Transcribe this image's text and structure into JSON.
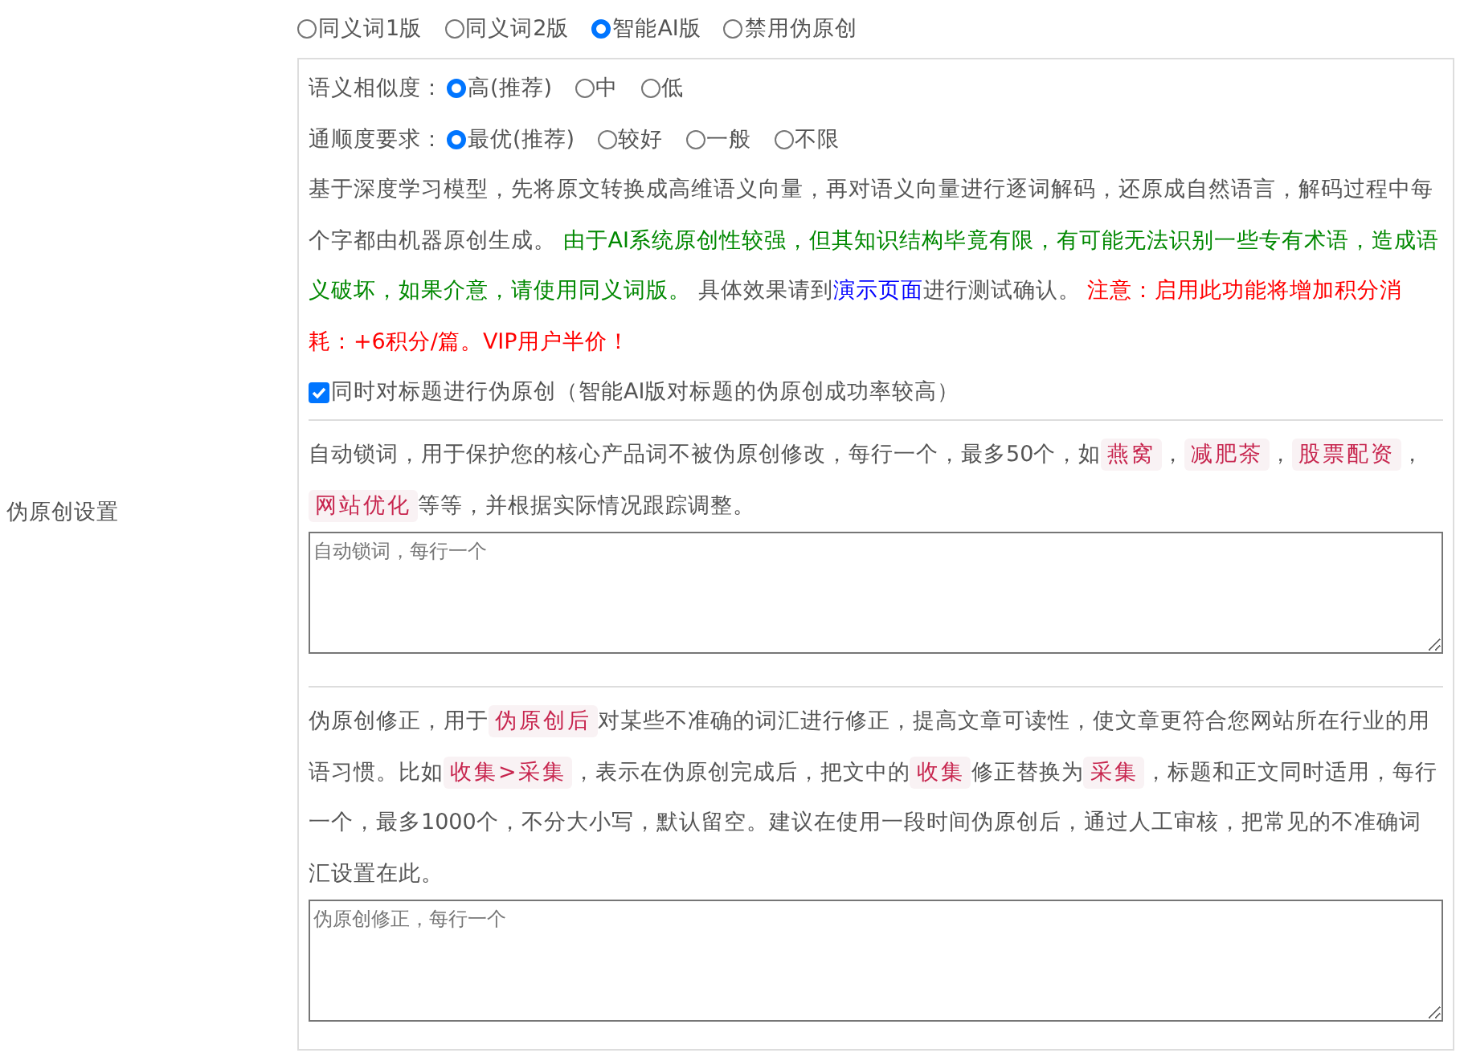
{
  "form_label": "伪原创设置",
  "modes": [
    {
      "label": "同义词1版",
      "selected": false
    },
    {
      "label": "同义词2版",
      "selected": false
    },
    {
      "label": "智能AI版",
      "selected": true
    },
    {
      "label": "禁用伪原创",
      "selected": false
    }
  ],
  "options": [
    {
      "label": "语义相似度：",
      "choices": [
        {
          "label": "高(推荐)",
          "selected": true
        },
        {
          "label": "中",
          "selected": false
        },
        {
          "label": "低",
          "selected": false
        }
      ]
    },
    {
      "label": "通顺度要求：",
      "choices": [
        {
          "label": "最优(推荐)",
          "selected": true
        },
        {
          "label": "较好",
          "selected": false
        },
        {
          "label": "一般",
          "selected": false
        },
        {
          "label": "不限",
          "selected": false
        }
      ]
    }
  ],
  "ai_description": [
    {
      "kind": "plain",
      "text": "基于深度学习模型，先将原文转换成高维语义向量，再对语义向量进行逐词解码，还原成自然语言，解码过程中每个字都由机器原创生成。 "
    },
    {
      "kind": "green",
      "text": "由于AI系统原创性较强，但其知识结构毕竟有限，有可能无法识别一些专有术语，造成语义破坏，如果介意，请使用同义词版。"
    },
    {
      "kind": "plain",
      "text": " 具体效果请到"
    },
    {
      "kind": "link",
      "text": "演示页面"
    },
    {
      "kind": "plain",
      "text": "进行测试确认。 "
    },
    {
      "kind": "red",
      "text": "注意：启用此功能将增加积分消耗：+6积分/篇。VIP用户半价！"
    }
  ],
  "title_rewrite": {
    "label": "同时对标题进行伪原创（智能AI版对标题的伪原创成功率较高）",
    "checked": true
  },
  "lock_words": {
    "description": [
      {
        "kind": "plain",
        "text": "自动锁词，用于保护您的核心产品词不被伪原创修改，每行一个，最多50个，如"
      },
      {
        "kind": "code",
        "text": "燕窝"
      },
      {
        "kind": "plain",
        "text": "，"
      },
      {
        "kind": "code",
        "text": "减肥茶"
      },
      {
        "kind": "plain",
        "text": "，"
      },
      {
        "kind": "code",
        "text": "股票配资"
      },
      {
        "kind": "plain",
        "text": "，"
      },
      {
        "kind": "code",
        "text": "网站优化"
      },
      {
        "kind": "plain",
        "text": "等等，并根据实际情况跟踪调整。"
      }
    ],
    "placeholder": "自动锁词，每行一个"
  },
  "corrections": {
    "description": [
      {
        "kind": "plain",
        "text": "伪原创修正，用于"
      },
      {
        "kind": "code",
        "text": "伪原创后"
      },
      {
        "kind": "plain",
        "text": "对某些不准确的词汇进行修正，提高文章可读性，使文章更符合您网站所在行业的用语习惯。比如"
      },
      {
        "kind": "code",
        "text": "收集>采集"
      },
      {
        "kind": "plain",
        "text": "，表示在伪原创完成后，把文中的"
      },
      {
        "kind": "code",
        "text": "收集"
      },
      {
        "kind": "plain",
        "text": "修正替换为"
      },
      {
        "kind": "code",
        "text": "采集"
      },
      {
        "kind": "plain",
        "text": "，标题和正文同时适用，每行一个，最多1000个，不分大小写，默认留空。建议在使用一段时间伪原创后，通过人工审核，把常见的不准确词汇设置在此。"
      }
    ],
    "placeholder": "伪原创修正，每行一个"
  }
}
